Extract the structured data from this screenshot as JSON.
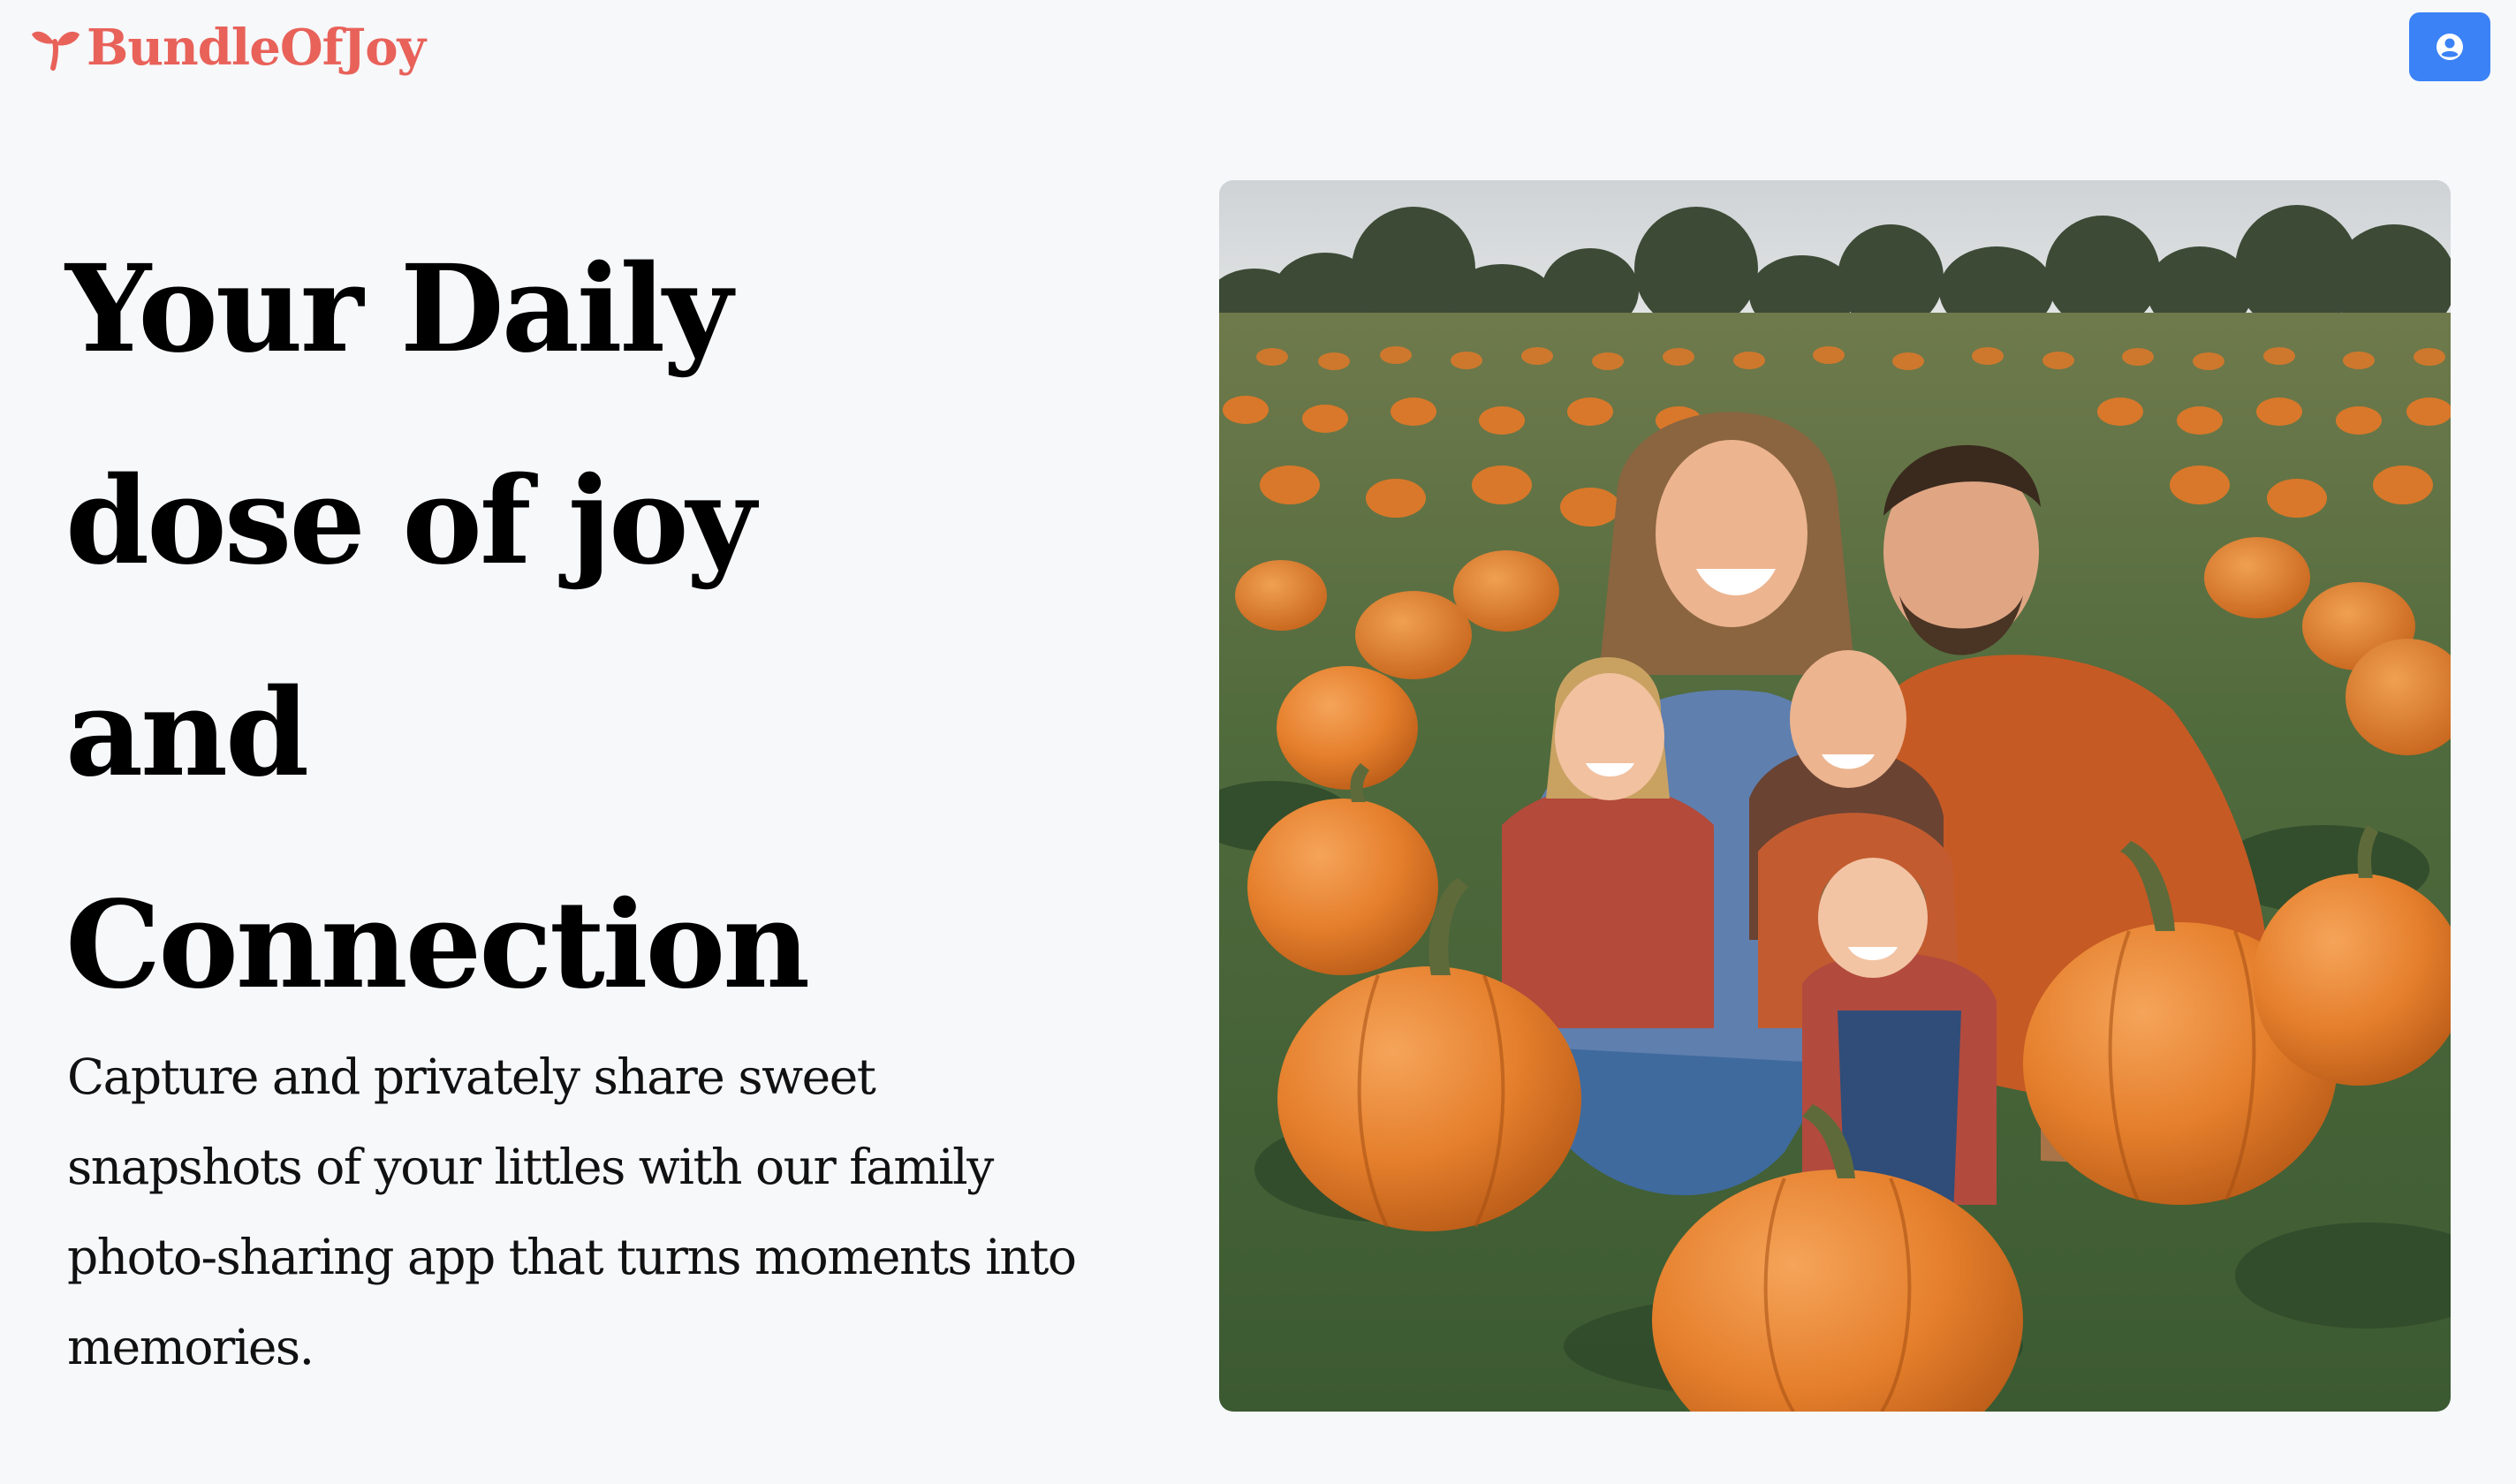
{
  "header": {
    "brand_name": "BundleOfJoy",
    "brand_icon": "sprout-icon",
    "account_icon": "user-circle-icon",
    "account_button_color": "#3b82f6",
    "brand_color": "#e8625a"
  },
  "hero": {
    "title_lines": [
      "Your Daily",
      "dose of joy",
      "and",
      "Connection"
    ],
    "description": "Capture and privately share sweet snapshots of your littles with our family photo-sharing app that turns moments into memories.",
    "image_icon": "family-photo-image"
  },
  "colors": {
    "background": "#f7f8fa",
    "title": "#000000",
    "text": "#111111"
  }
}
